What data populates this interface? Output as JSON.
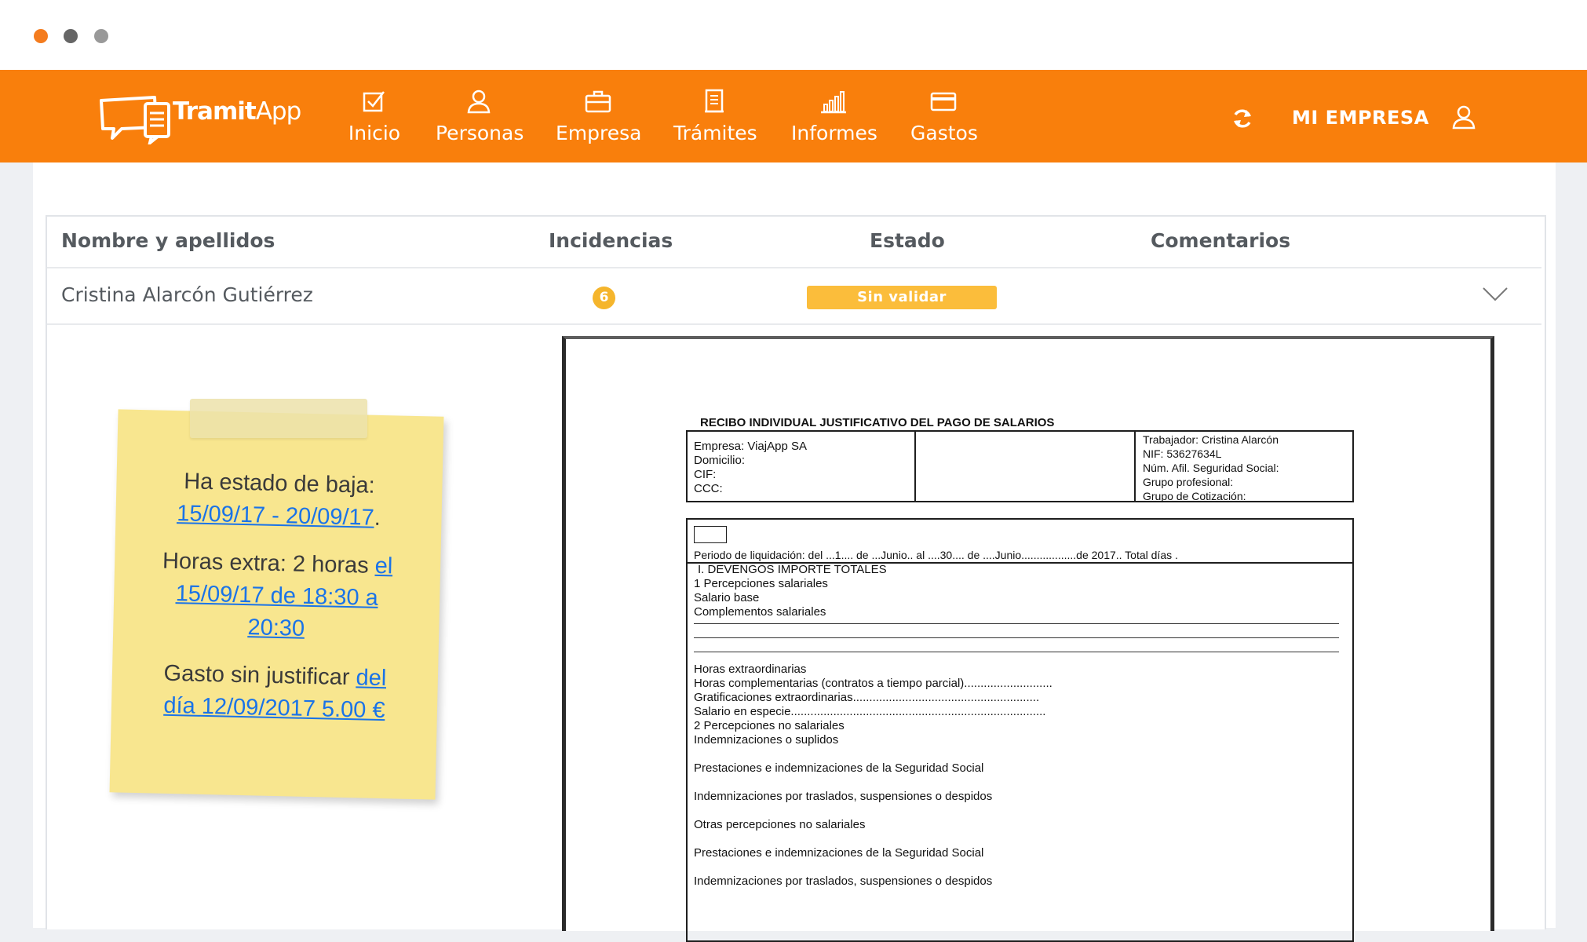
{
  "app": {
    "logo_text_bold": "Tramit",
    "logo_text_light": "App",
    "brand_color": "#f97f0c"
  },
  "nav": {
    "items": [
      {
        "label": "Inicio",
        "icon": "checkbox-icon"
      },
      {
        "label": "Personas",
        "icon": "user-icon"
      },
      {
        "label": "Empresa",
        "icon": "briefcase-icon"
      },
      {
        "label": "Trámites",
        "icon": "document-icon"
      },
      {
        "label": "Informes",
        "icon": "bar-chart-icon"
      },
      {
        "label": "Gastos",
        "icon": "credit-card-icon"
      }
    ],
    "company_label": "MI EMPRESA"
  },
  "table": {
    "headers": {
      "name": "Nombre y apellidos",
      "incidents": "Incidencias",
      "status": "Estado",
      "comments": "Comentarios"
    },
    "row": {
      "name": "Cristina Alarcón Gutiérrez",
      "incidents": "6",
      "status": "Sin validar"
    }
  },
  "note": {
    "line1": "Ha estado de baja:",
    "line1_link": "15/09/17 - 20/09/17",
    "line1_end": ".",
    "line2": "Horas extra: 2 horas",
    "line2_link_a": "el",
    "line2_link_b": "15/09/17 de 18:30 a",
    "line2_link_c": "20:30",
    "line3": "Gasto sin justificar",
    "line3_link_a": "del",
    "line3_link_b": "día 12/09/2017 5.00 €"
  },
  "document": {
    "title": "RECIBO INDIVIDUAL JUSTIFICATIVO DEL PAGO DE SALARIOS",
    "company": [
      "Empresa: ViajApp SA",
      "Domicilio:",
      "CIF:",
      "CCC:"
    ],
    "worker": [
      "Trabajador: Cristina Alarcón",
      "NIF: 53627634L",
      "Núm. Afil. Seguridad Social:",
      "Grupo profesional:",
      "Grupo de Cotización:"
    ],
    "period": "Periodo de liquidación: del ...1.... de ...Junio.. al ....30.... de ....Junio..................de 2017..  Total días        .",
    "section_title": "I. DEVENGOS IMPORTE TOTALES",
    "lines": [
      "1   Percepciones salariales",
      "Salario base",
      "Complementos salariales"
    ],
    "lines2": [
      "Horas extraordinarias",
      "Horas complementarias (contratos a tiempo parcial)...........................",
      "Gratificaciones extraordinarias.........................................................",
      "Salario en especie..............................................................................",
      "2   Percepciones no salariales",
      "Indemnizaciones o suplidos"
    ],
    "lines3": [
      "Prestaciones e indemnizaciones de la Seguridad Social",
      "Indemnizaciones por traslados, suspensiones o despidos",
      "Otras percepciones no salariales",
      "Prestaciones e indemnizaciones de la Seguridad Social",
      "Indemnizaciones por traslados, suspensiones o despidos"
    ]
  }
}
